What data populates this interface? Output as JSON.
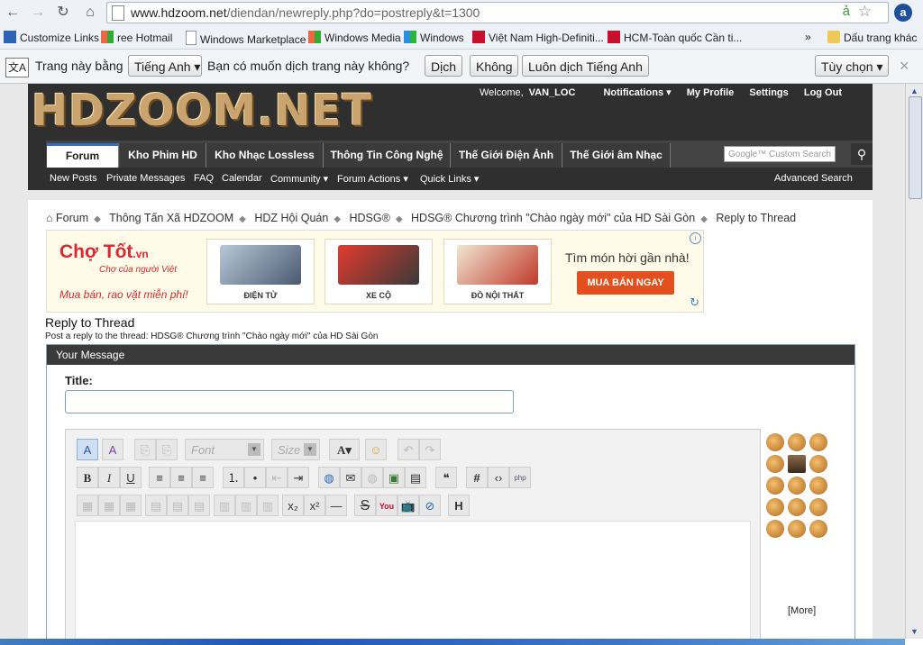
{
  "browser": {
    "url_host": "www.hdzoom.net",
    "url_path": "/diendan/newreply.php?do=postreply&t=1300",
    "bookmarks": [
      "Customize Links",
      "ree Hotmail",
      "Windows Marketplace",
      "Windows Media",
      "Windows",
      "Việt Nam High-Definiti...",
      "HCM-Toàn quốc Cần ti...",
      "»",
      "Dấu trang khác"
    ]
  },
  "translate_bar": {
    "label1": "Trang này bằng",
    "lang": "Tiếng Anh",
    "question": "Bạn có muốn dịch trang này không?",
    "translate_btn": "Dịch",
    "no_btn": "Không",
    "always_btn": "Luôn dịch Tiếng Anh",
    "options_btn": "Tùy chọn",
    "close": "×"
  },
  "header": {
    "logo": "HDZOOM.NET",
    "welcome": "Welcome,",
    "username": "VAN_LOC",
    "notifications": "Notifications",
    "profile": "My Profile",
    "settings": "Settings",
    "logout": "Log Out"
  },
  "tabs": [
    "Forum",
    "Kho Phim HD",
    "Kho Nhạc Lossless",
    "Thông Tin Công Nghệ",
    "Thế Giới Điện Ảnh",
    "Thế Giới âm Nhạc"
  ],
  "search": {
    "placeholder": "Google™ Custom Search"
  },
  "subnav": [
    "New Posts",
    "Private Messages",
    "FAQ",
    "Calendar",
    "Community",
    "Forum Actions",
    "Quick Links"
  ],
  "advanced_search": "Advanced Search",
  "breadcrumb": [
    "Forum",
    "Thông Tấn Xã HDZOOM",
    "HDZ Hội Quán",
    "HDSG®",
    "HDSG® Chương trình \"Chào ngày mới\" của HD Sài Gòn",
    "Reply to Thread"
  ],
  "ad": {
    "brand": "Chợ Tốt",
    "brand_suffix": ".vn",
    "sub": "Chợ của người Việt",
    "slogan": "Mua bán, rao vặt miễn phí!",
    "products": [
      "ĐIỆN TỬ",
      "XE CỘ",
      "ĐỒ NỘI THẤT"
    ],
    "cta_text": "Tìm món hời gần nhà!",
    "cta": "MUA BÁN NGAY"
  },
  "reply": {
    "heading": "Reply to Thread",
    "subheading": "Post a reply to the thread: HDSG® Chương trình \"Chào ngày mới\" của HD Sài Gòn",
    "box_title": "Your Message",
    "title_label": "Title:",
    "title_value": "",
    "font_placeholder": "Font",
    "size_placeholder": "Size",
    "more": "[More]"
  }
}
